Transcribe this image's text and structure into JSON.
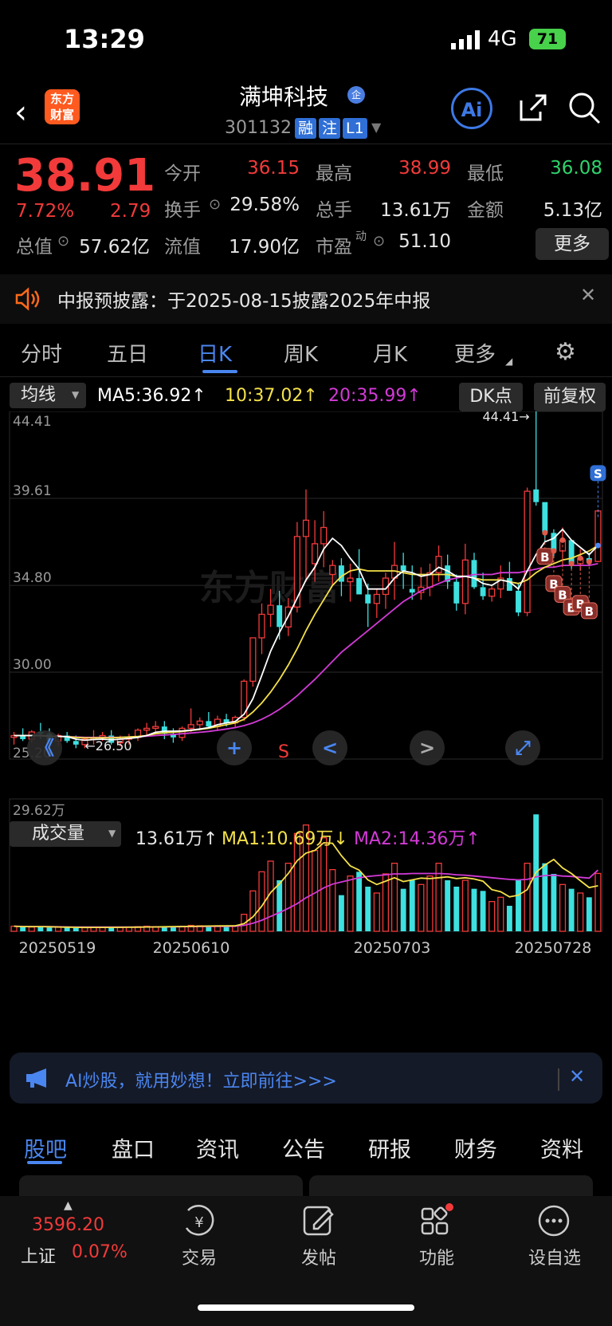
{
  "status_bar": {
    "time": "13:29",
    "network": "4G",
    "battery": "71"
  },
  "header": {
    "logo_text": "东方财富",
    "stock_name": "满坤科技",
    "badge": "企",
    "code": "301132",
    "tags": [
      "融",
      "注",
      "L1"
    ],
    "ai_label": "Ai"
  },
  "quote": {
    "price": "38.91",
    "change_pct": "7.72%",
    "change_amt": "2.79",
    "rows": [
      [
        {
          "label": "今开",
          "value": "36.15",
          "color": "red"
        },
        {
          "label": "最高",
          "value": "38.99",
          "color": "red"
        },
        {
          "label": "最低",
          "value": "36.08",
          "color": "green"
        }
      ],
      [
        {
          "label": "换手",
          "value": "29.58%",
          "color": "white"
        },
        {
          "label": "总手",
          "value": "13.61万",
          "color": "white"
        },
        {
          "label": "金额",
          "value": "5.13亿",
          "color": "white"
        }
      ],
      [
        {
          "label": "总值",
          "value": "57.62亿",
          "color": "white"
        },
        {
          "label": "流值",
          "value": "17.90亿",
          "color": "white"
        },
        {
          "label": "市盈",
          "value": "51.10",
          "color": "white"
        }
      ]
    ],
    "pe_superscript": "动",
    "more_label": "更多"
  },
  "notice": {
    "text": "中报预披露：于2025-08-15披露2025年中报"
  },
  "chart_tabs": [
    "分时",
    "五日",
    "日K",
    "周K",
    "月K",
    "更多"
  ],
  "active_chart_tab": "日K",
  "indicators": {
    "selector": "均线",
    "ma5": "MA5:36.92↑",
    "ma10": "10:37.02↑",
    "ma20": "20:35.99↑",
    "dk_label": "DK点",
    "fq_label": "前复权",
    "colors": {
      "ma5": "#ffffff",
      "ma10": "#f5e14a",
      "ma20": "#d23ad6",
      "up": "#f23a3a",
      "down": "#3ee0e0"
    }
  },
  "chart_data": {
    "type": "candlestick",
    "y_ticks": [
      "44.41",
      "39.61",
      "34.80",
      "30.00",
      "25.20"
    ],
    "ylim": [
      25.2,
      44.41
    ],
    "max_label": "44.41→",
    "min_label": "←26.50",
    "x_labels": [
      "20250519",
      "20250610",
      "20250703",
      "20250728"
    ],
    "candles": [
      [
        26.4,
        26.7,
        26.0,
        26.5
      ],
      [
        26.5,
        26.9,
        26.2,
        26.3
      ],
      [
        26.3,
        26.8,
        26.1,
        26.7
      ],
      [
        26.7,
        27.2,
        26.3,
        26.6
      ],
      [
        26.6,
        26.9,
        26.0,
        26.2
      ],
      [
        26.2,
        26.6,
        25.9,
        26.5
      ],
      [
        26.5,
        26.7,
        26.1,
        26.2
      ],
      [
        26.2,
        26.5,
        25.8,
        26.0
      ],
      [
        26.0,
        26.4,
        25.8,
        26.3
      ],
      [
        26.3,
        26.8,
        26.0,
        26.4
      ],
      [
        26.4,
        26.7,
        26.2,
        26.5
      ],
      [
        26.5,
        26.8,
        26.0,
        26.1
      ],
      [
        26.1,
        26.5,
        25.9,
        26.3
      ],
      [
        26.3,
        26.6,
        26.0,
        26.4
      ],
      [
        26.4,
        26.9,
        26.2,
        26.8
      ],
      [
        26.8,
        27.2,
        26.5,
        26.9
      ],
      [
        26.9,
        27.3,
        26.6,
        27.0
      ],
      [
        27.0,
        27.3,
        26.3,
        26.6
      ],
      [
        26.6,
        26.9,
        26.1,
        26.4
      ],
      [
        26.4,
        27.0,
        26.2,
        26.9
      ],
      [
        26.9,
        28.0,
        26.7,
        27.1
      ],
      [
        27.1,
        27.5,
        26.8,
        27.3
      ],
      [
        27.3,
        27.8,
        26.9,
        27.0
      ],
      [
        27.0,
        27.6,
        26.8,
        27.4
      ],
      [
        27.4,
        27.7,
        27.0,
        27.2
      ],
      [
        27.2,
        27.6,
        26.9,
        27.5
      ],
      [
        27.5,
        29.6,
        27.3,
        29.5
      ],
      [
        29.5,
        31.9,
        29.2,
        31.9
      ],
      [
        31.9,
        33.8,
        31.0,
        33.2
      ],
      [
        33.2,
        34.6,
        32.5,
        33.7
      ],
      [
        33.7,
        34.5,
        31.8,
        32.5
      ],
      [
        32.5,
        34.1,
        32.0,
        33.6
      ],
      [
        33.6,
        38.3,
        33.3,
        37.5
      ],
      [
        37.5,
        40.1,
        35.0,
        38.4
      ],
      [
        36.0,
        38.4,
        35.0,
        37.1
      ],
      [
        37.1,
        38.9,
        35.8,
        38.0
      ],
      [
        35.4,
        36.2,
        34.8,
        35.9
      ],
      [
        35.9,
        36.3,
        34.2,
        35.0
      ],
      [
        35.0,
        36.0,
        33.9,
        35.2
      ],
      [
        35.2,
        36.8,
        34.5,
        34.3
      ],
      [
        34.3,
        34.9,
        32.5,
        33.8
      ],
      [
        33.8,
        34.6,
        33.0,
        34.3
      ],
      [
        34.3,
        35.5,
        33.5,
        35.2
      ],
      [
        35.2,
        37.2,
        34.0,
        35.9
      ],
      [
        35.9,
        36.6,
        34.6,
        35.6
      ],
      [
        34.6,
        35.9,
        34.0,
        34.4
      ],
      [
        34.4,
        35.8,
        34.0,
        34.7
      ],
      [
        34.7,
        36.0,
        34.2,
        35.5
      ],
      [
        35.5,
        37.0,
        35.0,
        36.4
      ],
      [
        35.9,
        36.5,
        34.6,
        35.0
      ],
      [
        35.0,
        35.4,
        33.4,
        33.8
      ],
      [
        33.8,
        37.1,
        33.2,
        36.2
      ],
      [
        36.2,
        36.6,
        34.6,
        34.7
      ],
      [
        34.7,
        35.5,
        34.0,
        34.2
      ],
      [
        34.2,
        34.8,
        33.9,
        34.6
      ],
      [
        34.6,
        35.9,
        34.1,
        35.2
      ],
      [
        35.2,
        36.1,
        34.6,
        34.5
      ],
      [
        34.5,
        34.9,
        33.1,
        33.3
      ],
      [
        33.3,
        40.2,
        33.1,
        40.0
      ],
      [
        40.1,
        44.41,
        39.2,
        39.4
      ],
      [
        39.4,
        38.3,
        37.2,
        37.7
      ],
      [
        37.7,
        37.9,
        36.3,
        36.7
      ],
      [
        36.7,
        38.0,
        35.8,
        37.3
      ],
      [
        37.3,
        37.3,
        35.7,
        36.0
      ],
      [
        36.0,
        36.8,
        35.6,
        36.3
      ],
      [
        36.3,
        36.6,
        35.9,
        36.1
      ],
      [
        36.12,
        38.99,
        36.08,
        38.91
      ]
    ],
    "ma5": [
      26.5,
      26.5,
      26.5,
      26.5,
      26.46,
      26.46,
      26.44,
      26.3,
      26.24,
      26.28,
      26.3,
      26.26,
      26.3,
      26.34,
      26.4,
      26.5,
      26.68,
      26.74,
      26.74,
      26.76,
      26.8,
      26.86,
      26.94,
      27.1,
      27.2,
      27.28,
      27.68,
      28.54,
      29.82,
      31.16,
      32.2,
      33.1,
      34.1,
      35.1,
      35.8,
      36.8,
      37.4,
      37.0,
      36.3,
      35.7,
      34.6,
      34.6,
      34.6,
      35.2,
      35.6,
      35.5,
      35.3,
      35.4,
      35.8,
      35.6,
      35.3,
      35.3,
      35.2,
      34.9,
      34.8,
      35.1,
      35.0,
      34.6,
      35.6,
      36.5,
      37.2,
      37.4,
      37.9,
      37.3,
      36.9,
      36.5,
      37.0
    ],
    "ma10": [
      26.5,
      26.5,
      26.5,
      26.5,
      26.46,
      26.45,
      26.44,
      26.4,
      26.37,
      26.37,
      26.38,
      26.37,
      26.4,
      26.42,
      26.45,
      26.5,
      26.6,
      26.65,
      26.68,
      26.72,
      26.78,
      26.84,
      26.9,
      27.0,
      27.1,
      27.2,
      27.4,
      27.8,
      28.3,
      28.9,
      29.6,
      30.4,
      31.3,
      32.3,
      33.2,
      34.0,
      34.8,
      35.3,
      35.6,
      35.7,
      35.6,
      35.6,
      35.6,
      35.6,
      35.5,
      35.4,
      35.4,
      35.4,
      35.4,
      35.4,
      35.3,
      35.3,
      35.2,
      35.1,
      35.1,
      35.1,
      35.0,
      34.9,
      35.1,
      35.5,
      35.8,
      36.0,
      36.2,
      36.3,
      36.5,
      36.7,
      37.0
    ],
    "ma20": [
      26.5,
      26.5,
      26.5,
      26.48,
      26.46,
      26.45,
      26.44,
      26.42,
      26.4,
      26.4,
      26.4,
      26.4,
      26.4,
      26.42,
      26.44,
      26.46,
      26.5,
      26.53,
      26.56,
      26.6,
      26.64,
      26.68,
      26.73,
      26.79,
      26.86,
      26.94,
      27.05,
      27.2,
      27.4,
      27.65,
      27.95,
      28.3,
      28.7,
      29.15,
      29.6,
      30.1,
      30.6,
      31.1,
      31.5,
      31.9,
      32.3,
      32.7,
      33.1,
      33.5,
      33.9,
      34.2,
      34.5,
      34.7,
      34.9,
      35.1,
      35.2,
      35.3,
      35.4,
      35.4,
      35.4,
      35.5,
      35.5,
      35.5,
      35.6,
      35.7,
      35.8,
      35.8,
      35.9,
      35.9,
      35.9,
      35.9,
      36.0
    ],
    "volume": {
      "selector": "成交量",
      "current": "13.61万↑",
      "ma1": "MA1:10.69万↓",
      "ma2": "MA2:14.36万↑",
      "max_label": "29.62万",
      "ylim": [
        0,
        29.62
      ],
      "values": [
        1.2,
        1.1,
        1.0,
        1.1,
        0.9,
        1.0,
        0.9,
        0.8,
        0.9,
        1.0,
        1.0,
        0.9,
        0.9,
        1.0,
        1.1,
        1.2,
        1.1,
        1.0,
        1.1,
        1.2,
        1.4,
        1.3,
        1.2,
        1.3,
        1.2,
        1.3,
        4.0,
        9.5,
        14.0,
        16.5,
        12.0,
        16.0,
        23.0,
        25.0,
        19.0,
        22.0,
        14.5,
        8.5,
        13.0,
        14.0,
        10.5,
        9.0,
        13.5,
        16.0,
        10.0,
        12.0,
        11.0,
        13.0,
        16.0,
        12.0,
        10.5,
        12.0,
        10.0,
        9.5,
        7.0,
        8.0,
        6.0,
        12.0,
        16.0,
        27.5,
        16.0,
        13.5,
        11.0,
        10.0,
        9.0,
        8.0,
        13.6
      ],
      "ma1_values": [
        1.2,
        1.1,
        1.1,
        1.1,
        1.06,
        1.02,
        0.98,
        0.94,
        0.9,
        0.92,
        0.92,
        0.92,
        0.94,
        0.96,
        0.98,
        1.02,
        1.04,
        1.06,
        1.1,
        1.12,
        1.16,
        1.2,
        1.24,
        1.26,
        1.28,
        1.3,
        1.8,
        3.4,
        5.9,
        9.1,
        11.2,
        13.6,
        16.6,
        18.4,
        19.0,
        20.8,
        20.7,
        17.8,
        15.4,
        14.4,
        12.1,
        11.0,
        11.8,
        12.6,
        11.7,
        12.1,
        12.5,
        12.4,
        12.6,
        12.8,
        12.4,
        12.6,
        12.3,
        11.8,
        9.8,
        9.3,
        8.1,
        8.5,
        9.8,
        13.9,
        15.6,
        16.9,
        14.9,
        13.6,
        11.9,
        10.3,
        10.7
      ],
      "ma2_values": [
        1.2,
        1.15,
        1.1,
        1.1,
        1.08,
        1.06,
        1.04,
        1.02,
        1.0,
        1.0,
        1.0,
        1.0,
        1.0,
        1.0,
        1.0,
        1.02,
        1.03,
        1.04,
        1.06,
        1.08,
        1.1,
        1.12,
        1.14,
        1.15,
        1.16,
        1.18,
        1.4,
        1.9,
        2.6,
        3.5,
        4.4,
        5.4,
        6.5,
        7.9,
        9.0,
        10.2,
        11.1,
        11.6,
        12.1,
        12.6,
        12.9,
        13.1,
        13.3,
        13.5,
        13.5,
        13.6,
        13.6,
        13.6,
        13.6,
        13.5,
        13.3,
        13.2,
        13.0,
        12.8,
        12.6,
        12.4,
        12.2,
        12.1,
        12.2,
        12.8,
        13.1,
        13.2,
        13.0,
        12.9,
        12.7,
        12.5,
        14.4
      ]
    }
  },
  "chart_controls": [
    "《",
    "+",
    "S",
    "<",
    ">",
    "⤢"
  ],
  "markers": {
    "sell": "S",
    "buy": "B"
  },
  "ai_banner": {
    "text": "AI炒股，就用妙想！立即前往>>>"
  },
  "bottom_tabs": [
    "股吧",
    "盘口",
    "资讯",
    "公告",
    "研报",
    "财务",
    "资料"
  ],
  "bottom_nav": {
    "index_value": "3596.20",
    "index_name": "上证",
    "index_change": "0.07%",
    "items": [
      {
        "icon": "yen-circle-icon",
        "label": "交易"
      },
      {
        "icon": "edit-icon",
        "label": "发帖"
      },
      {
        "icon": "grid-icon",
        "label": "功能"
      },
      {
        "icon": "dots-circle-icon",
        "label": "设自选"
      }
    ]
  }
}
